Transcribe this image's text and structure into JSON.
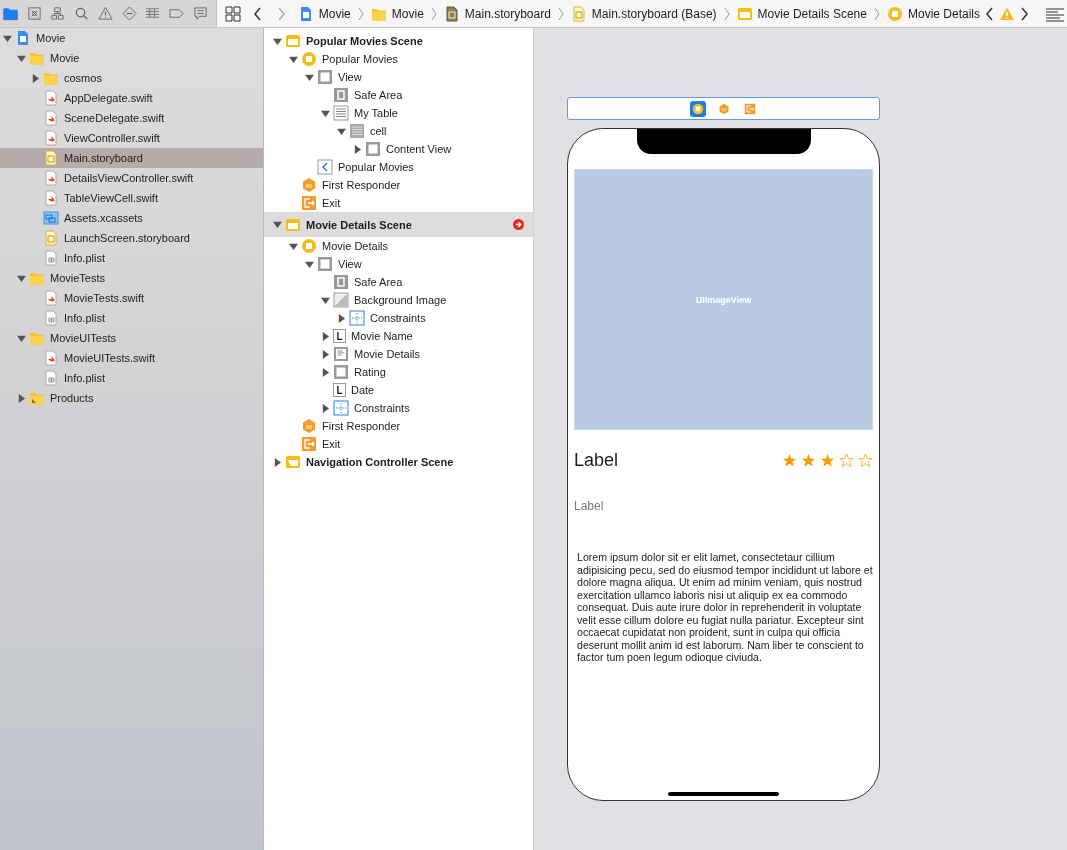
{
  "navigator_toolbar": [
    {
      "kind": "folder",
      "selected": true
    },
    {
      "kind": "source-control",
      "selected": false
    },
    {
      "kind": "hierarchy",
      "selected": false
    },
    {
      "kind": "search",
      "selected": false
    },
    {
      "kind": "warning",
      "selected": false
    },
    {
      "kind": "test",
      "selected": false
    },
    {
      "kind": "debug",
      "selected": false
    },
    {
      "kind": "breakpoint",
      "selected": false
    },
    {
      "kind": "report",
      "selected": false
    }
  ],
  "breadcrumb": [
    {
      "kind": "project",
      "label": "Movie"
    },
    {
      "kind": "folder",
      "label": "Movie"
    },
    {
      "kind": "storyboard-dark",
      "label": "Main.storyboard"
    },
    {
      "kind": "storyboard",
      "label": "Main.storyboard (Base)"
    },
    {
      "kind": "scene",
      "label": "Movie Details Scene"
    },
    {
      "kind": "controller",
      "label": "Movie Details"
    }
  ],
  "project_tree": [
    {
      "label": "Movie",
      "kind": "project",
      "expanded": true,
      "selected": false,
      "children": [
        {
          "label": "Movie",
          "kind": "folder",
          "expanded": true,
          "selected": false,
          "children": [
            {
              "label": "cosmos",
              "kind": "folder",
              "expanded": false,
              "selected": false
            },
            {
              "label": "AppDelegate.swift",
              "kind": "swift",
              "selected": false
            },
            {
              "label": "SceneDelegate.swift",
              "kind": "swift",
              "selected": false
            },
            {
              "label": "ViewController.swift",
              "kind": "swift",
              "selected": false
            },
            {
              "label": "Main.storyboard",
              "kind": "storyboard",
              "selected": true
            },
            {
              "label": "DetailsViewController.swift",
              "kind": "swift",
              "selected": false
            },
            {
              "label": "TableViewCell.swift",
              "kind": "swift",
              "selected": false
            },
            {
              "label": "Assets.xcassets",
              "kind": "assets",
              "selected": false
            },
            {
              "label": "LaunchScreen.storyboard",
              "kind": "storyboard",
              "selected": false
            },
            {
              "label": "Info.plist",
              "kind": "plist",
              "selected": false
            }
          ]
        },
        {
          "label": "MovieTests",
          "kind": "folder",
          "expanded": true,
          "selected": false,
          "children": [
            {
              "label": "MovieTests.swift",
              "kind": "swift",
              "selected": false
            },
            {
              "label": "Info.plist",
              "kind": "plist",
              "selected": false
            }
          ]
        },
        {
          "label": "MovieUITests",
          "kind": "folder",
          "expanded": true,
          "selected": false,
          "children": [
            {
              "label": "MovieUITests.swift",
              "kind": "swift",
              "selected": false
            },
            {
              "label": "Info.plist",
              "kind": "plist",
              "selected": false
            }
          ]
        },
        {
          "label": "Products",
          "kind": "products",
          "expanded": false,
          "selected": false
        }
      ]
    }
  ],
  "document_outline": [
    {
      "label": "Popular Movies Scene",
      "kind": "scene",
      "expanded": true,
      "selected": false,
      "children": [
        {
          "label": "Popular Movies",
          "kind": "controller",
          "expanded": true,
          "selected": false,
          "children": [
            {
              "label": "View",
              "kind": "view",
              "expanded": true,
              "selected": false,
              "children": [
                {
                  "label": "Safe Area",
                  "kind": "safe-area",
                  "selected": false
                },
                {
                  "label": "My Table",
                  "kind": "table",
                  "expanded": true,
                  "selected": false,
                  "children": [
                    {
                      "label": "cell",
                      "kind": "cell",
                      "expanded": true,
                      "selected": false,
                      "children": [
                        {
                          "label": "Content View",
                          "kind": "view",
                          "expanded": false,
                          "selected": false
                        }
                      ]
                    }
                  ]
                }
              ]
            },
            {
              "label": "Popular Movies",
              "kind": "nav-item",
              "selected": false
            }
          ]
        },
        {
          "label": "First Responder",
          "kind": "responder",
          "selected": false
        },
        {
          "label": "Exit",
          "kind": "exit",
          "selected": false
        }
      ]
    },
    {
      "label": "Movie Details Scene",
      "kind": "scene",
      "expanded": true,
      "selected": true,
      "issue": true,
      "children": [
        {
          "label": "Movie Details",
          "kind": "controller",
          "expanded": true,
          "selected": false,
          "children": [
            {
              "label": "View",
              "kind": "view",
              "expanded": true,
              "selected": false,
              "children": [
                {
                  "label": "Safe Area",
                  "kind": "safe-area",
                  "selected": false
                },
                {
                  "label": "Background Image",
                  "kind": "image-view",
                  "expanded": true,
                  "selected": false,
                  "children": [
                    {
                      "label": "Constraints",
                      "kind": "constraints",
                      "expanded": false,
                      "selected": false
                    }
                  ]
                },
                {
                  "label": "Movie Name",
                  "kind": "label",
                  "icon_text": "L",
                  "expanded": false,
                  "selected": false
                },
                {
                  "label": "Movie Details",
                  "kind": "text-view",
                  "expanded": false,
                  "selected": false
                },
                {
                  "label": "Rating",
                  "kind": "view",
                  "expanded": false,
                  "selected": false
                },
                {
                  "label": "Date",
                  "kind": "label",
                  "icon_text": "L",
                  "selected": false
                },
                {
                  "label": "Constraints",
                  "kind": "constraints",
                  "expanded": false,
                  "selected": false
                }
              ]
            }
          ]
        },
        {
          "label": "First Responder",
          "kind": "responder",
          "selected": false
        },
        {
          "label": "Exit",
          "kind": "exit",
          "selected": false
        }
      ]
    },
    {
      "label": "Navigation Controller Scene",
      "kind": "scene-nav",
      "expanded": false,
      "selected": false
    }
  ],
  "scene_dock": [
    {
      "kind": "controller",
      "selected": true
    },
    {
      "kind": "responder",
      "selected": false
    },
    {
      "kind": "exit",
      "selected": false
    }
  ],
  "device": {
    "image_placeholder": "UIImageView",
    "title": "Label",
    "stars": 3,
    "subtitle": "Label",
    "body": "Lorem ipsum dolor sit er elit lamet, consectetaur cillium adipisicing pecu, sed do eiusmod tempor incididunt ut labore et dolore magna aliqua. Ut enim ad minim veniam, quis nostrud exercitation ullamco laboris nisi ut aliquip ex ea commodo consequat. Duis aute irure dolor in reprehenderit in voluptate velit esse cillum dolore eu fugiat nulla pariatur. Excepteur sint occaecat cupidatat non proident, sunt in culpa qui officia deserunt mollit anim id est laborum. Nam liber te conscient to factor tum poen legum odioque civiuda."
  }
}
